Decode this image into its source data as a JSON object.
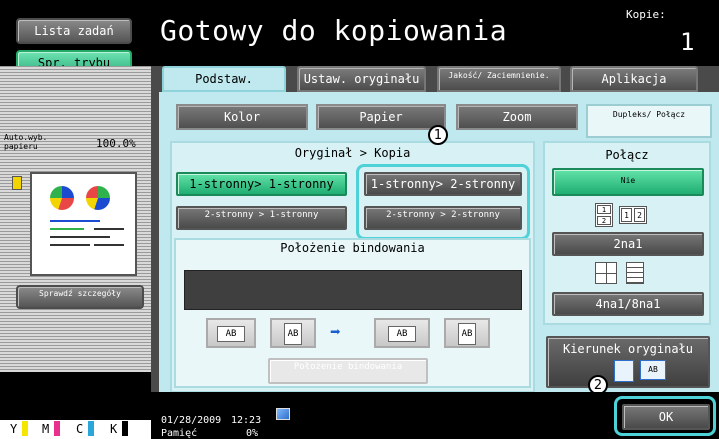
{
  "header": {
    "title": "Gotowy do kopiowania",
    "copies_label": "Kopie:",
    "copies_value": "1"
  },
  "sidebar": {
    "job_list_label": "Lista zadań",
    "check_mode_label": "Spr. trybu",
    "auto_paper_label": "Auto.wyb. papieru",
    "zoom_value": "100.0%",
    "check_details_label": "Sprawdź szczegóły",
    "toner": [
      "Y",
      "M",
      "C",
      "K"
    ],
    "toner_colors": [
      "#f5e600",
      "#e8318e",
      "#2aa6d9",
      "#000000"
    ]
  },
  "tabs": [
    {
      "label": "Podstaw.",
      "active": true
    },
    {
      "label": "Ustaw. oryginału",
      "active": false
    },
    {
      "label": "Jakość/ Zaciemnienie.",
      "active": false
    },
    {
      "label": "Aplikacja",
      "active": false
    }
  ],
  "subtabs": [
    {
      "label": "Kolor",
      "active": false
    },
    {
      "label": "Papier",
      "active": false
    },
    {
      "label": "Zoom",
      "active": false
    },
    {
      "label": "Dupleks/ Połącz",
      "active": true
    }
  ],
  "duplex": {
    "title": "Oryginał > Kopia",
    "buttons": [
      {
        "label": "1-stronny> 1-stronny",
        "selected": true
      },
      {
        "label": "1-stronny> 2-stronny",
        "selected": false
      },
      {
        "label": "2-stronny > 1-stronny",
        "selected": false
      },
      {
        "label": "2-stronny > 2-stronny",
        "selected": false
      }
    ],
    "binding_title": "Położenie bindowania",
    "binding_button": "Położenie bindowania",
    "binding_icon_labels": [
      "AB",
      "AB",
      "AB",
      "AB"
    ]
  },
  "combine": {
    "title": "Połącz",
    "none_label": "Nie",
    "twoin1_label": "2na1",
    "fourin1_label": "4na1/8na1",
    "twoin1_icon_labels": [
      "2",
      "1",
      "2"
    ]
  },
  "orientation": {
    "label": "Kierunek oryginału",
    "icon_label": "AB"
  },
  "ok_label": "OK",
  "callouts": [
    "1",
    "2"
  ],
  "status": {
    "date": "01/28/2009",
    "time": "12:23",
    "memory_label": "Pamięć",
    "memory_value": "0%"
  }
}
